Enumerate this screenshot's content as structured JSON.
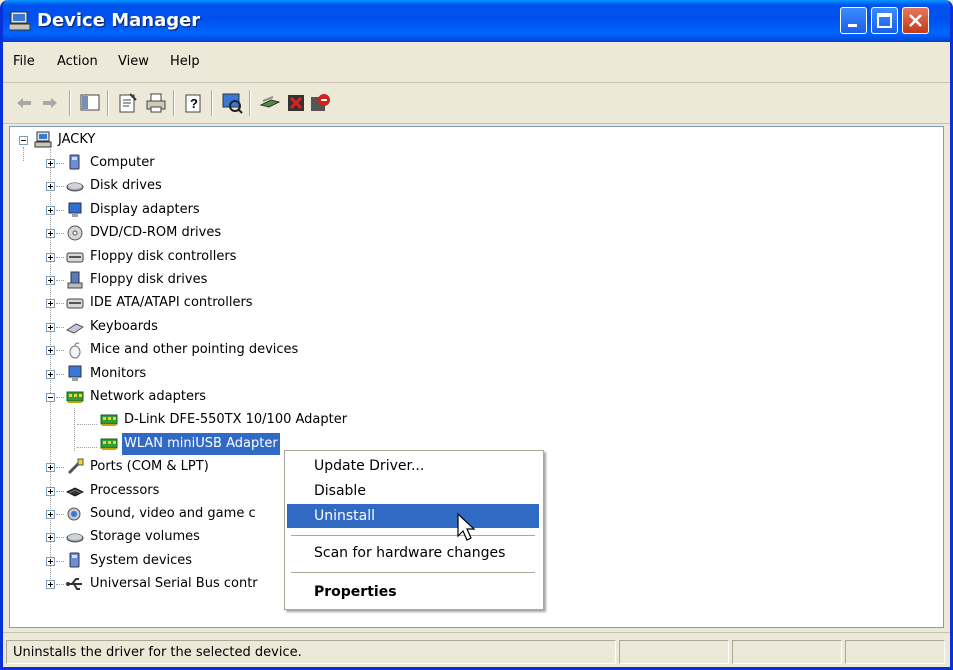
{
  "window": {
    "title": "Device Manager"
  },
  "menu": [
    "File",
    "Action",
    "View",
    "Help"
  ],
  "toolbar": {
    "icons": [
      "back-arrow-icon",
      "forward-arrow-icon",
      "show-hide-tree-icon",
      "properties-icon",
      "print-icon",
      "help-icon",
      "scan-hardware-icon",
      "update-driver-icon",
      "uninstall-icon",
      "disable-icon"
    ]
  },
  "tree": {
    "root": "JACKY",
    "items": [
      {
        "label": "Computer",
        "icon": "computer-icon"
      },
      {
        "label": "Disk drives",
        "icon": "disk-drive-icon"
      },
      {
        "label": "Display adapters",
        "icon": "display-adapter-icon"
      },
      {
        "label": "DVD/CD-ROM drives",
        "icon": "cdrom-icon"
      },
      {
        "label": "Floppy disk controllers",
        "icon": "controller-icon"
      },
      {
        "label": "Floppy disk drives",
        "icon": "floppy-icon"
      },
      {
        "label": "IDE ATA/ATAPI controllers",
        "icon": "controller-icon"
      },
      {
        "label": "Keyboards",
        "icon": "keyboard-icon"
      },
      {
        "label": "Mice and other pointing devices",
        "icon": "mouse-icon"
      },
      {
        "label": "Monitors",
        "icon": "monitor-icon"
      },
      {
        "label": "Network adapters",
        "icon": "network-adapter-icon"
      },
      {
        "label": "Ports (COM & LPT)",
        "icon": "port-icon"
      },
      {
        "label": "Processors",
        "icon": "processor-icon"
      },
      {
        "label": "Sound, video and game c",
        "icon": "sound-icon"
      },
      {
        "label": "Storage volumes",
        "icon": "storage-icon"
      },
      {
        "label": "System devices",
        "icon": "system-device-icon"
      },
      {
        "label": "Universal Serial Bus contr",
        "icon": "usb-icon"
      }
    ],
    "network_children": [
      "D-Link DFE-550TX 10/100 Adapter",
      "WLAN miniUSB Adapter"
    ]
  },
  "context_menu": {
    "items": [
      "Update Driver...",
      "Disable",
      "Uninstall",
      "Scan for hardware changes",
      "Properties"
    ],
    "highlighted": "Uninstall"
  },
  "status": {
    "text": "Uninstalls the driver for the selected device."
  },
  "colors": {
    "selection": "#316ac5",
    "titlebar": "#0054e3"
  }
}
